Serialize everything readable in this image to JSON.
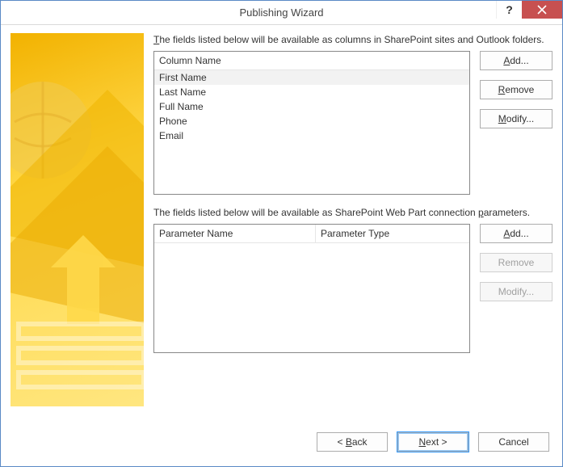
{
  "titlebar": {
    "title": "Publishing Wizard"
  },
  "columns_section": {
    "intro_pre": "T",
    "intro_rest": "he fields listed below will be available as columns in SharePoint sites and Outlook folders.",
    "header": "Column Name",
    "rows": [
      "First Name",
      "Last Name",
      "Full Name",
      "Phone",
      "Email"
    ],
    "buttons": {
      "add_pre": "A",
      "add_rest": "dd...",
      "remove_pre": "R",
      "remove_rest": "emove",
      "modify_pre": "M",
      "modify_rest": "odify..."
    }
  },
  "params_section": {
    "intro_pre": "The fields listed below will be available as SharePoint Web Part connection ",
    "intro_u": "p",
    "intro_post": "arameters.",
    "header_name": "Parameter Name",
    "header_type": "Parameter Type",
    "buttons": {
      "add_pre": "A",
      "add_rest": "dd...",
      "remove": "Remove",
      "modify": "Modify..."
    }
  },
  "footer": {
    "back_pre": "< ",
    "back_u": "B",
    "back_rest": "ack",
    "next_u": "N",
    "next_rest": "ext >",
    "cancel": "Cancel"
  }
}
